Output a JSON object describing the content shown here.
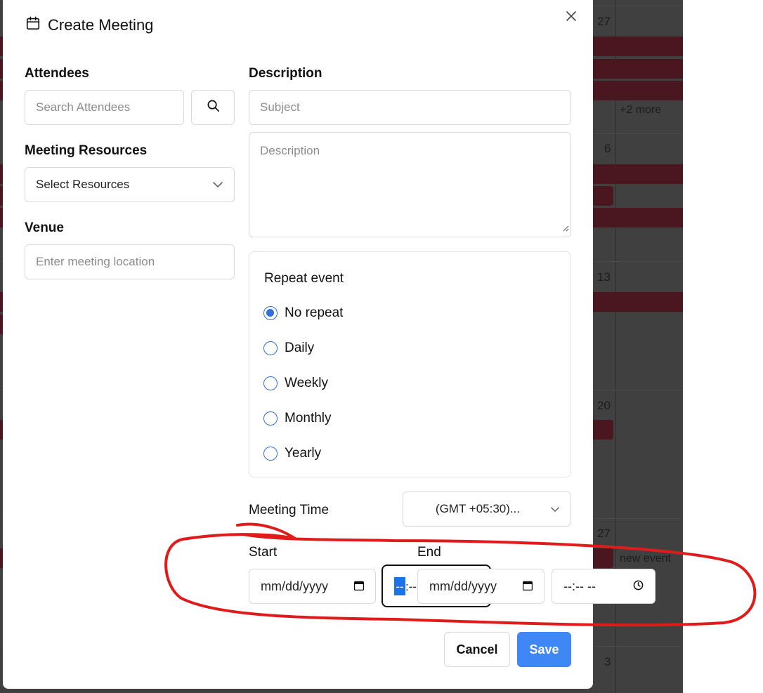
{
  "modal": {
    "title": "Create Meeting",
    "calendar_icon": "calendar-icon",
    "close_icon": "close-icon"
  },
  "left": {
    "attendees_label": "Attendees",
    "attendees_placeholder": "Search Attendees",
    "resources_label": "Meeting Resources",
    "resources_value": "Select Resources",
    "venue_label": "Venue",
    "venue_placeholder": "Enter meeting location"
  },
  "right": {
    "description_label": "Description",
    "subject_placeholder": "Subject",
    "description_placeholder": "Description"
  },
  "repeat": {
    "title": "Repeat event",
    "options": [
      "No repeat",
      "Daily",
      "Weekly",
      "Monthly",
      "Yearly"
    ],
    "selected": "No repeat"
  },
  "time": {
    "label": "Meeting Time",
    "timezone": "(GMT +05:30)...",
    "start_label": "Start",
    "end_label": "End",
    "start_date": "mm/dd/yyyy",
    "start_time_partial": "--",
    "start_time_rest": ":--",
    "end_date": "mm/dd/yyyy",
    "end_time": "--:-- --"
  },
  "actions": {
    "cancel": "Cancel",
    "save": "Save"
  },
  "background_calendar": {
    "day_numbers": [
      "27",
      "6",
      "13",
      "20",
      "27",
      "3"
    ],
    "more_text": "+2 more",
    "event_text": "new event"
  },
  "colors": {
    "accent": "#3f87f5",
    "radio": "#2f6fd6",
    "annotation": "#e01b1b",
    "event_band": "#4a1620"
  }
}
